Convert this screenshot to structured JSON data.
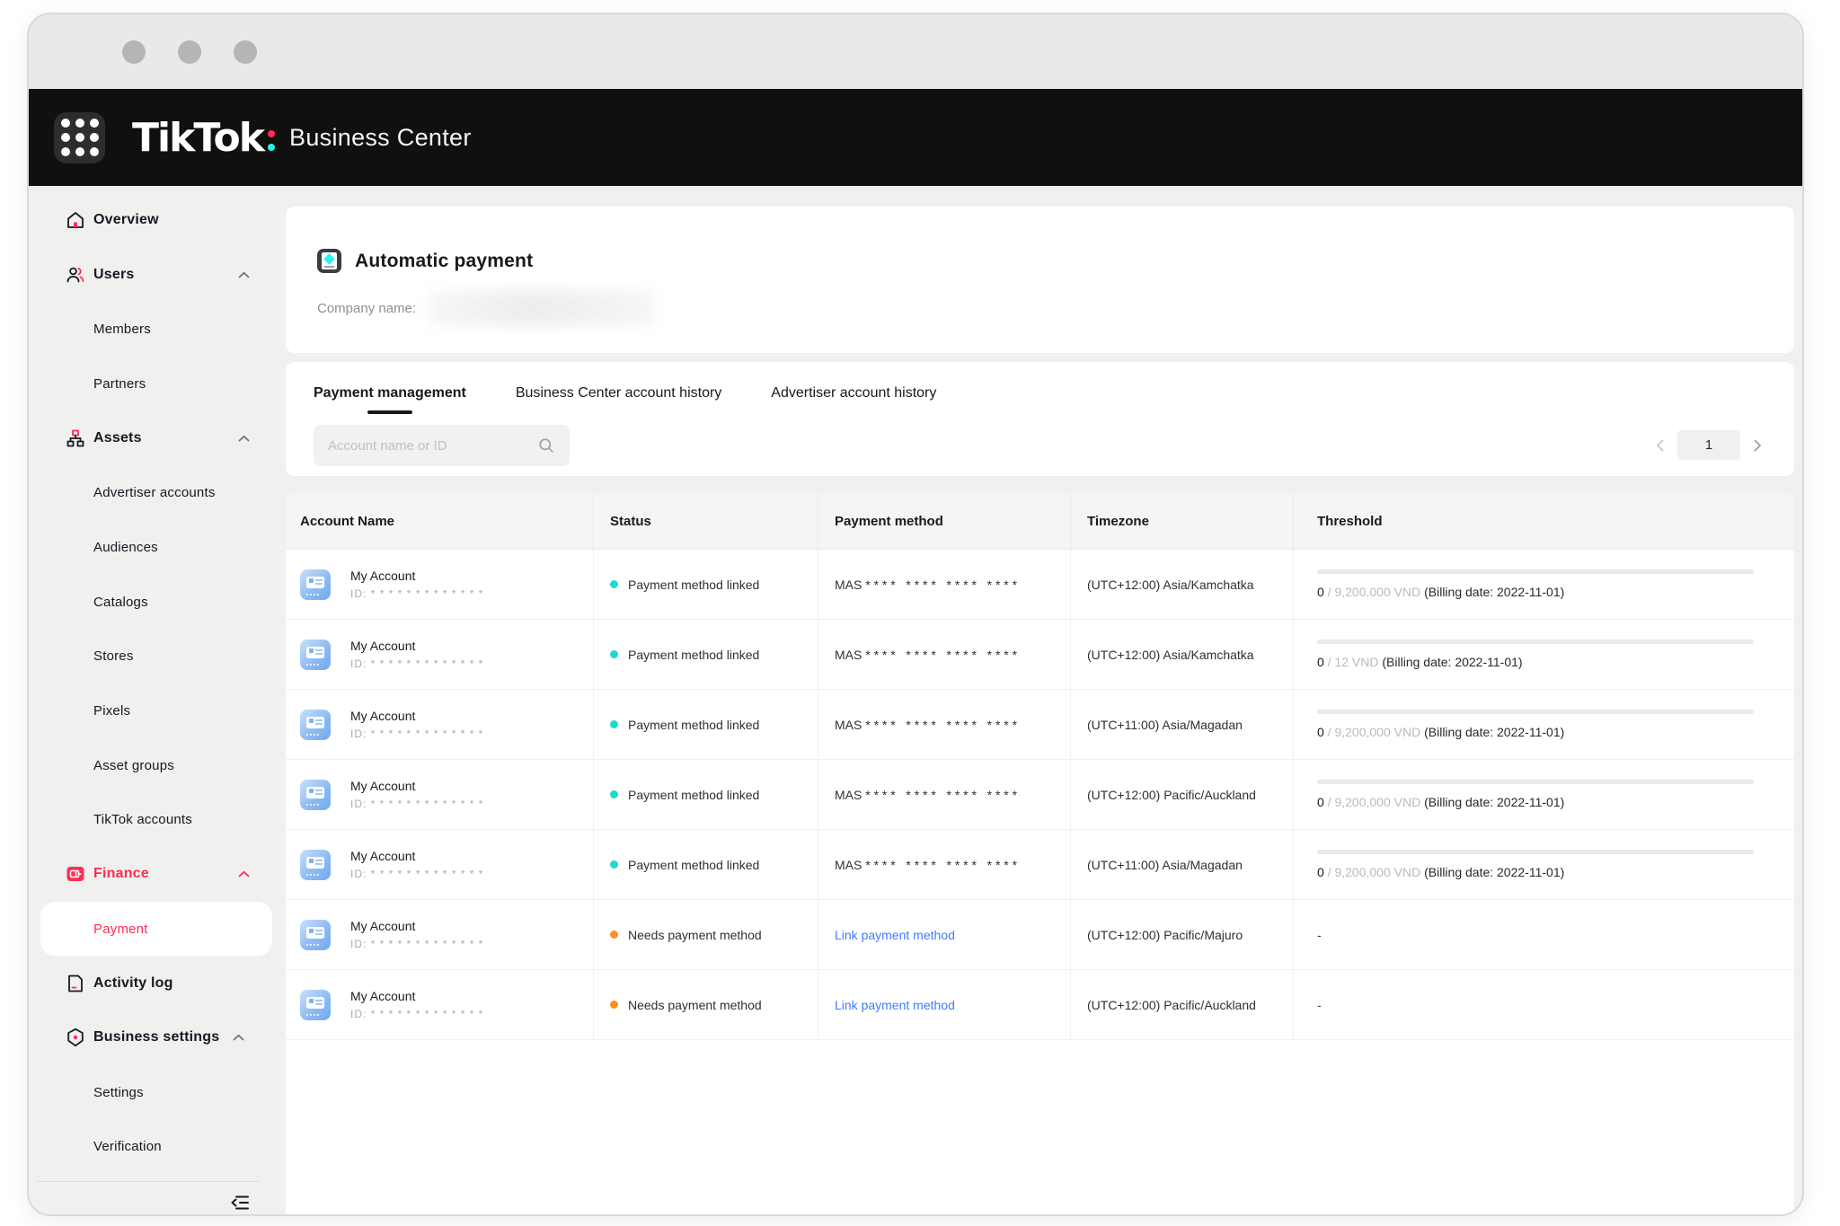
{
  "header": {
    "logo": "TikTok",
    "product": "Business Center"
  },
  "colors": {
    "accent_pink": "#FE2C55",
    "accent_teal": "#25F4EE",
    "status_linked_dot": "#1ED9CE",
    "status_needs_dot": "#FF8F1F",
    "link_blue": "#3D7DFF",
    "topbar_black": "#101010"
  },
  "sidebar": {
    "items": [
      {
        "label": "Overview",
        "type": "top",
        "icon": "home"
      },
      {
        "label": "Users",
        "type": "top",
        "icon": "users",
        "expanded": true
      },
      {
        "label": "Members",
        "type": "sub"
      },
      {
        "label": "Partners",
        "type": "sub"
      },
      {
        "label": "Assets",
        "type": "top",
        "icon": "assets",
        "expanded": true
      },
      {
        "label": "Advertiser accounts",
        "type": "sub"
      },
      {
        "label": "Audiences",
        "type": "sub"
      },
      {
        "label": "Catalogs",
        "type": "sub"
      },
      {
        "label": "Stores",
        "type": "sub"
      },
      {
        "label": "Pixels",
        "type": "sub"
      },
      {
        "label": "Asset groups",
        "type": "sub"
      },
      {
        "label": "TikTok accounts",
        "type": "sub"
      },
      {
        "label": "Finance",
        "type": "top",
        "icon": "finance",
        "expanded": true,
        "highlighted": true
      },
      {
        "label": "Payment",
        "type": "sub",
        "active": true
      },
      {
        "label": "Activity log",
        "type": "top",
        "icon": "activity-log"
      },
      {
        "label": "Business settings",
        "type": "top",
        "icon": "business-settings",
        "expanded": true
      },
      {
        "label": "Settings",
        "type": "sub"
      },
      {
        "label": "Verification",
        "type": "sub"
      }
    ]
  },
  "page": {
    "title": "Automatic payment",
    "company_label": "Company name:"
  },
  "tabs": [
    {
      "label": "Payment management",
      "active": true
    },
    {
      "label": "Business Center account history",
      "active": false
    },
    {
      "label": "Advertiser account history",
      "active": false
    }
  ],
  "search": {
    "placeholder": "Account name or ID"
  },
  "pagination": {
    "page": "1"
  },
  "table": {
    "headers": [
      "Account Name",
      "Status",
      "Payment method",
      "Timezone",
      "Threshold"
    ],
    "rows": [
      {
        "name": "My Account",
        "id": "ID: * * * * * * * * * * * * *",
        "status": "Payment method linked",
        "status_type": "linked",
        "payment": "MAS * * * *   * * * *   * * * *   * * * *",
        "timezone": "(UTC+12:00) Asia/Kamchatka",
        "threshold": {
          "used": "0",
          "limit": " / 9,200,000 VND ",
          "billing": "(Billing date: 2022-11-01)"
        }
      },
      {
        "name": "My Account",
        "id": "ID: * * * * * * * * * * * * *",
        "status": "Payment method linked",
        "status_type": "linked",
        "payment": "MAS * * * *   * * * *   * * * *   * * * *",
        "timezone": "(UTC+12:00) Asia/Kamchatka",
        "threshold": {
          "used": "0",
          "limit": " / 12 VND ",
          "billing": "(Billing date: 2022-11-01)"
        }
      },
      {
        "name": "My Account",
        "id": "ID: * * * * * * * * * * * * *",
        "status": "Payment method linked",
        "status_type": "linked",
        "payment": "MAS * * * *   * * * *   * * * *   * * * *",
        "timezone": "(UTC+11:00) Asia/Magadan",
        "threshold": {
          "used": "0",
          "limit": " / 9,200,000 VND ",
          "billing": "(Billing date: 2022-11-01)"
        }
      },
      {
        "name": "My Account",
        "id": "ID: * * * * * * * * * * * * *",
        "status": "Payment method linked",
        "status_type": "linked",
        "payment": "MAS * * * *   * * * *   * * * *   * * * *",
        "timezone": "(UTC+12:00) Pacific/Auckland",
        "threshold": {
          "used": "0",
          "limit": " / 9,200,000 VND ",
          "billing": "(Billing date: 2022-11-01)"
        }
      },
      {
        "name": "My Account",
        "id": "ID: * * * * * * * * * * * * *",
        "status": "Payment method linked",
        "status_type": "linked",
        "payment": "MAS * * * *   * * * *   * * * *   * * * *",
        "timezone": "(UTC+11:00) Asia/Magadan",
        "threshold": {
          "used": "0",
          "limit": " / 9,200,000 VND ",
          "billing": "(Billing date: 2022-11-01)"
        }
      },
      {
        "name": "My Account",
        "id": "ID: * * * * * * * * * * * * *",
        "status": "Needs payment method",
        "status_type": "needs",
        "payment_link": "Link payment method",
        "timezone": "(UTC+12:00) Pacific/Majuro",
        "threshold": {
          "dash": "-"
        }
      },
      {
        "name": "My Account",
        "id": "ID: * * * * * * * * * * * * *",
        "status": "Needs payment method",
        "status_type": "needs",
        "payment_link": "Link payment method",
        "timezone": "(UTC+12:00) Pacific/Auckland",
        "threshold": {
          "dash": "-"
        }
      }
    ]
  }
}
